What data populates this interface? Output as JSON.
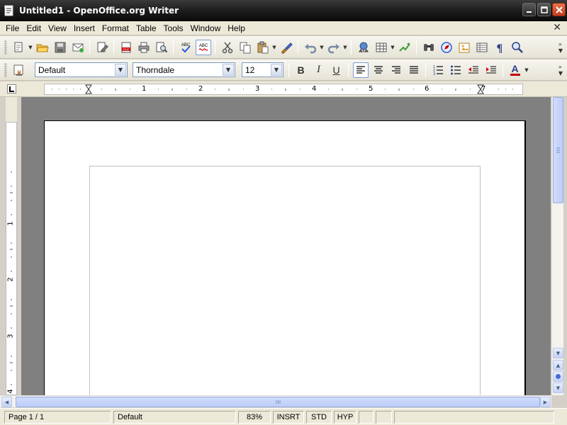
{
  "window": {
    "title": "Untitled1 - OpenOffice.org Writer"
  },
  "menu": {
    "items": [
      "File",
      "Edit",
      "View",
      "Insert",
      "Format",
      "Table",
      "Tools",
      "Window",
      "Help"
    ],
    "close_glyph": "✕"
  },
  "toolbar_standard": {
    "icons": [
      "new-document-icon",
      "open-folder-icon",
      "save-icon",
      "email-icon",
      "edit-file-icon",
      "export-pdf-icon",
      "print-icon",
      "page-preview-icon",
      "spellcheck-icon",
      "autospellcheck-icon",
      "cut-icon",
      "copy-icon",
      "paste-icon",
      "format-paintbrush-icon",
      "undo-icon",
      "redo-icon",
      "hyperlink-icon",
      "table-icon",
      "show-draw-functions-icon",
      "find-replace-icon",
      "navigator-icon",
      "gallery-icon",
      "data-sources-icon",
      "formatting-marks-icon",
      "zoom-icon"
    ]
  },
  "toolbar_formatting": {
    "paragraph_style": "Default",
    "font_name": "Thorndale",
    "font_size": "12",
    "bold": "B",
    "italic": "I",
    "underline": "U",
    "font_color_letter": "A",
    "align_active": "left"
  },
  "ruler": {
    "h_labels": [
      "1",
      "2",
      "3",
      "4",
      "5",
      "6",
      "7"
    ],
    "v_labels": [
      "1",
      "2",
      "3",
      "4"
    ]
  },
  "statusbar": {
    "page": "Page 1 / 1",
    "style": "Default",
    "zoom": "83%",
    "insert_mode": "INSRT",
    "selection_mode": "STD",
    "hyperlink_mode": "HYP"
  },
  "colors": {
    "titlebar": "#1e1e1e",
    "menubar": "#ece9d8",
    "doc_background": "#808080",
    "font_color_bar": "#c00000"
  }
}
